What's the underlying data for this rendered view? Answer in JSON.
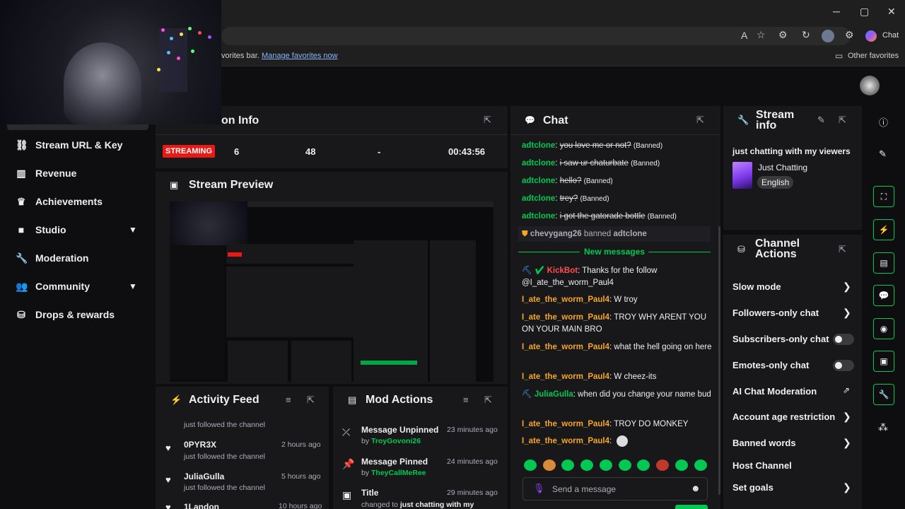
{
  "browser": {
    "fav_bar_text": "vorites bar.",
    "fav_bar_link": "Manage favorites now",
    "other_favorites": "Other favorites",
    "chat_button": "Chat"
  },
  "nav": {
    "items": [
      {
        "label": "Stream URL & Key",
        "icon": "link-icon"
      },
      {
        "label": "Revenue",
        "icon": "chart-icon"
      },
      {
        "label": "Achievements",
        "icon": "trophy-icon"
      },
      {
        "label": "Studio",
        "icon": "camera-icon"
      },
      {
        "label": "Moderation",
        "icon": "wrench-icon"
      },
      {
        "label": "Community",
        "icon": "people-icon"
      },
      {
        "label": "Drops & rewards",
        "icon": "gift-icon"
      }
    ]
  },
  "session": {
    "title": "on Info",
    "status": "STREAMING",
    "viewers": "6",
    "followers": "48",
    "subs": "-",
    "time": "00:43:56"
  },
  "preview": {
    "title": "Stream Preview"
  },
  "chat": {
    "title": "Chat",
    "banned_lines": [
      {
        "user": "adtclone",
        "text": "you love me or not?",
        "tag": "(Banned)"
      },
      {
        "user": "adtclone",
        "text": "i saw ur chaturbate",
        "tag": "(Banned)"
      },
      {
        "user": "adtclone",
        "text": "hello?",
        "tag": "(Banned)"
      },
      {
        "user": "adtclone",
        "text": "trey?",
        "tag": "(Banned)"
      },
      {
        "user": "adtclone",
        "text": "i got the gatorade bottle",
        "tag": "(Banned)"
      }
    ],
    "ban_notice": {
      "actor": "chevygang26",
      "verb": "banned",
      "target": "adtclone"
    },
    "new_messages": "New messages",
    "messages": [
      {
        "user": "KickBot",
        "text": "Thanks for the follow @I_ate_the_worm_Paul4"
      },
      {
        "user": "I_ate_the_worm_Paul4",
        "text": "W troy"
      },
      {
        "user": "I_ate_the_worm_Paul4",
        "text": "TROY WHY ARENT YOU ON YOUR MAIN BRO"
      },
      {
        "user": "I_ate_the_worm_Paul4",
        "text": "what the hell going on here"
      },
      {
        "user": "I_ate_the_worm_Paul4",
        "text": "W cheez-its"
      },
      {
        "user": "JuliaGulla",
        "text": "when did you change your name bud"
      },
      {
        "user": "I_ate_the_worm_Paul4",
        "text": "TROY DO MONKEY"
      },
      {
        "user": "I_ate_the_worm_Paul4",
        "text": ""
      }
    ],
    "input_placeholder": "Send a message"
  },
  "stream_info": {
    "title": "Stream info",
    "stream_title": "just chatting with my viewers",
    "category": "Just Chatting",
    "language": "English"
  },
  "channel_actions": {
    "title": "Channel Actions",
    "items": [
      {
        "label": "Slow mode",
        "control": "chevron"
      },
      {
        "label": "Followers-only chat",
        "control": "chevron"
      },
      {
        "label": "Subscribers-only chat",
        "control": "toggle"
      },
      {
        "label": "Emotes-only chat",
        "control": "toggle"
      },
      {
        "label": "AI Chat Moderation",
        "control": "external"
      },
      {
        "label": "Account age restriction",
        "control": "chevron"
      },
      {
        "label": "Banned words",
        "control": "chevron"
      },
      {
        "label": "Host Channel",
        "control": "none"
      },
      {
        "label": "Set goals",
        "control": "chevron"
      }
    ]
  },
  "activity_feed": {
    "title": "Activity Feed",
    "top_sub": "just followed the channel",
    "items": [
      {
        "name": "0PYR3X",
        "sub": "just followed the channel",
        "time": "2 hours ago"
      },
      {
        "name": "JuliaGulla",
        "sub": "just followed the channel",
        "time": "5 hours ago"
      },
      {
        "name": "1Landon",
        "sub": "",
        "time": "10 hours ago"
      }
    ]
  },
  "mod_actions": {
    "title": "Mod Actions",
    "items": [
      {
        "title": "Message Unpinned",
        "by_label": "by",
        "by": "TroyGovoni26",
        "time": "23 minutes ago"
      },
      {
        "title": "Message Pinned",
        "by_label": "by",
        "by": "TheyCallMeRee",
        "time": "24 minutes ago"
      },
      {
        "title": "Title",
        "by_label": "changed to",
        "by": "just chatting with my",
        "time": "29 minutes ago"
      }
    ]
  },
  "colors": {
    "accent": "#00c853",
    "streaming": "#e91916",
    "username": "#f5a623"
  }
}
